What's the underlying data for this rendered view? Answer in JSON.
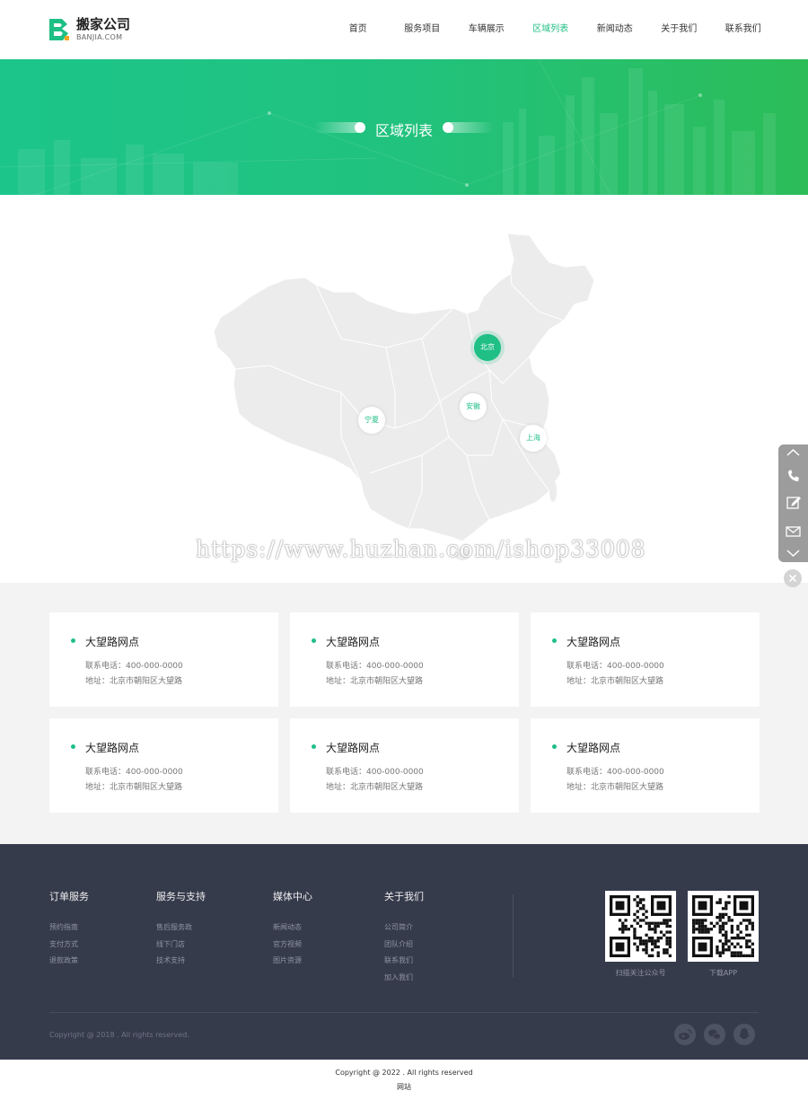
{
  "header": {
    "logo_cn": "搬家公司",
    "logo_en": "BANJIA.COM",
    "nav": [
      "首页",
      "服务项目",
      "车辆展示",
      "区域列表",
      "新闻动态",
      "关于我们",
      "联系我们"
    ],
    "active_nav": "区域列表"
  },
  "banner": {
    "title": "区域列表"
  },
  "map": {
    "pins": [
      "北京",
      "安徽",
      "宁夏",
      "上海"
    ],
    "active_pin": "北京"
  },
  "watermark": "https://www.huzhan.com/ishop33008",
  "cards": [
    {
      "name": "大望路网点",
      "phone": "联系电话：400-000-0000",
      "address": "地址：北京市朝阳区大望路"
    },
    {
      "name": "大望路网点",
      "phone": "联系电话：400-000-0000",
      "address": "地址：北京市朝阳区大望路"
    },
    {
      "name": "大望路网点",
      "phone": "联系电话：400-000-0000",
      "address": "地址：北京市朝阳区大望路"
    },
    {
      "name": "大望路网点",
      "phone": "联系电话：400-000-0000",
      "address": "地址：北京市朝阳区大望路"
    },
    {
      "name": "大望路网点",
      "phone": "联系电话：400-000-0000",
      "address": "地址：北京市朝阳区大望路"
    },
    {
      "name": "大望路网点",
      "phone": "联系电话：400-000-0000",
      "address": "地址：北京市朝阳区大望路"
    }
  ],
  "footer": {
    "columns": [
      {
        "title": "订单服务",
        "links": [
          "预约指南",
          "支付方式",
          "退款政策"
        ]
      },
      {
        "title": "服务与支持",
        "links": [
          "售后服务政",
          "线下门店",
          "技术支持"
        ]
      },
      {
        "title": "媒体中心",
        "links": [
          "新闻动态",
          "官方视频",
          "图片资源"
        ]
      },
      {
        "title": "关于我们",
        "links": [
          "公司简介",
          "团队介绍",
          "联系我们",
          "加入我们"
        ]
      }
    ],
    "qr_codes": [
      "扫描关注公众号",
      "下载APP"
    ],
    "copyright": "Copyright @ 2018 . All rights reserved.",
    "social_icons": [
      "weibo-icon",
      "wechat-icon",
      "qq-icon"
    ]
  },
  "bottom": {
    "copyright": "Copyright @ 2022 . All rights reserved",
    "label": "网站"
  },
  "side_tool": {
    "icons": [
      "chevron-up-icon",
      "phone-icon",
      "edit-icon",
      "mail-icon",
      "chevron-down-icon"
    ]
  },
  "colors": {
    "accent": "#1fbf86",
    "footer_bg": "#363b4c",
    "cards_bg": "#f3f3f3"
  }
}
